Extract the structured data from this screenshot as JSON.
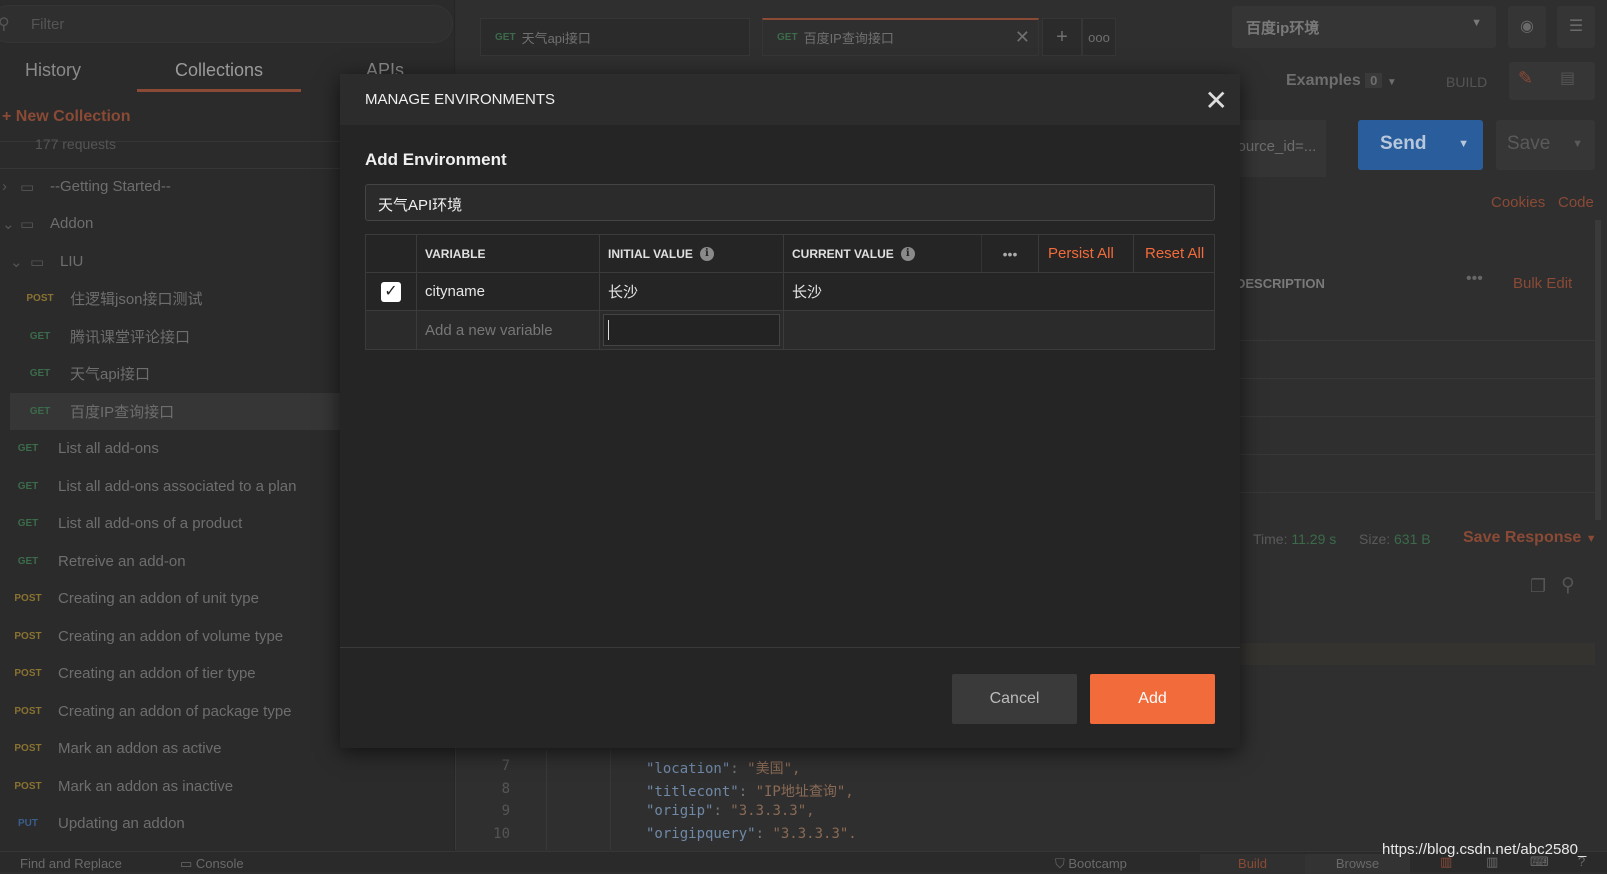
{
  "sidebar": {
    "filter_placeholder": "Filter",
    "tabs": [
      "History",
      "Collections",
      "APIs"
    ],
    "new_collection": "+ New Collection",
    "requests_count": "177 requests",
    "folders": [
      "--Getting Started--",
      "Addon",
      "LIU"
    ],
    "items": [
      {
        "method": "POST",
        "label": "住逻辑json接口测试"
      },
      {
        "method": "GET",
        "label": "腾讯课堂评论接口"
      },
      {
        "method": "GET",
        "label": "天气api接口"
      },
      {
        "method": "GET",
        "label": "百度IP查询接口"
      },
      {
        "method": "GET",
        "label": "List all add-ons"
      },
      {
        "method": "GET",
        "label": "List all add-ons associated to a plan"
      },
      {
        "method": "GET",
        "label": "List all add-ons of a product"
      },
      {
        "method": "GET",
        "label": "Retreive an add-on"
      },
      {
        "method": "POST",
        "label": "Creating an addon of unit type"
      },
      {
        "method": "POST",
        "label": "Creating an addon of volume type"
      },
      {
        "method": "POST",
        "label": "Creating an addon of tier type"
      },
      {
        "method": "POST",
        "label": "Creating an addon of package type"
      },
      {
        "method": "POST",
        "label": "Mark an addon as active"
      },
      {
        "method": "POST",
        "label": "Mark an addon as inactive"
      },
      {
        "method": "PUT",
        "label": "Updating an addon"
      }
    ]
  },
  "tabs": [
    {
      "method": "GET",
      "label": "天气api接口"
    },
    {
      "method": "GET",
      "label": "百度IP查询接口"
    }
  ],
  "environment_selected": "百度ip环境",
  "examples": {
    "label": "Examples",
    "count": "0"
  },
  "build_label": "BUILD",
  "url_fragment": "source_id=...",
  "send": "Send",
  "save": "Save",
  "cookies": "Cookies",
  "code": "Code",
  "params": {
    "description_header": "DESCRIPTION",
    "bulk_edit": "Bulk Edit"
  },
  "response": {
    "time_label": "Time:",
    "time": "11.29 s",
    "size_label": "Size:",
    "size": "631 B",
    "save_response": "Save Response"
  },
  "code_lines": [
    {
      "n": "7",
      "key": "\"location\"",
      "val": "\"美国\","
    },
    {
      "n": "8",
      "key": "\"titlecont\"",
      "val": "\"IP地址查询\","
    },
    {
      "n": "9",
      "key": "\"origip\"",
      "val": "\"3.3.3.3\","
    },
    {
      "n": "10",
      "key": "\"origipquery\"",
      "val": "\"3.3.3.3\"."
    }
  ],
  "footer": {
    "find_replace": "Find and Replace",
    "console": "Console",
    "bootcamp": "Bootcamp",
    "build": "Build",
    "browse": "Browse"
  },
  "watermark": "https://blog.csdn.net/abc2580_",
  "modal": {
    "title": "MANAGE ENVIRONMENTS",
    "subtitle": "Add Environment",
    "env_name": "天气API环境",
    "headers": {
      "variable": "VARIABLE",
      "initial": "INITIAL VALUE",
      "current": "CURRENT VALUE",
      "persist_all": "Persist All",
      "reset_all": "Reset All"
    },
    "rows": [
      {
        "enabled": true,
        "variable": "cityname",
        "initial": "长沙",
        "current": "长沙"
      }
    ],
    "new_variable_placeholder": "Add a new variable",
    "cancel": "Cancel",
    "add": "Add"
  },
  "colors": {
    "accent": "#f26b3a",
    "send": "#2a6bb8",
    "get": "#3b6b4a",
    "post": "#8a7230",
    "put": "#3a5e8a"
  }
}
